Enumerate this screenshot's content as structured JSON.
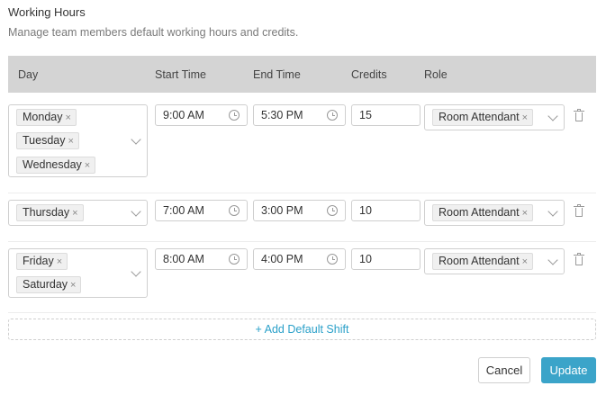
{
  "header": {
    "title": "Working Hours",
    "subtitle": "Manage team members default working hours and credits."
  },
  "table": {
    "columns": [
      "Day",
      "Start Time",
      "End Time",
      "Credits",
      "Role"
    ],
    "rows": [
      {
        "days": [
          "Monday",
          "Tuesday",
          "Wednesday"
        ],
        "start_time": "9:00 AM",
        "end_time": "5:30 PM",
        "credits": "15",
        "role": "Room Attendant"
      },
      {
        "days": [
          "Thursday"
        ],
        "start_time": "7:00 AM",
        "end_time": "3:00 PM",
        "credits": "10",
        "role": "Room Attendant"
      },
      {
        "days": [
          "Friday",
          "Saturday"
        ],
        "start_time": "8:00 AM",
        "end_time": "4:00 PM",
        "credits": "10",
        "role": "Room Attendant"
      }
    ]
  },
  "tag_remove_glyph": "×",
  "add_shift_label": "+ Add Default Shift",
  "buttons": {
    "cancel": "Cancel",
    "update": "Update"
  },
  "colors": {
    "accent": "#3ba4c9",
    "link": "#2aa0c9",
    "header_bg": "#d4d4d4"
  }
}
